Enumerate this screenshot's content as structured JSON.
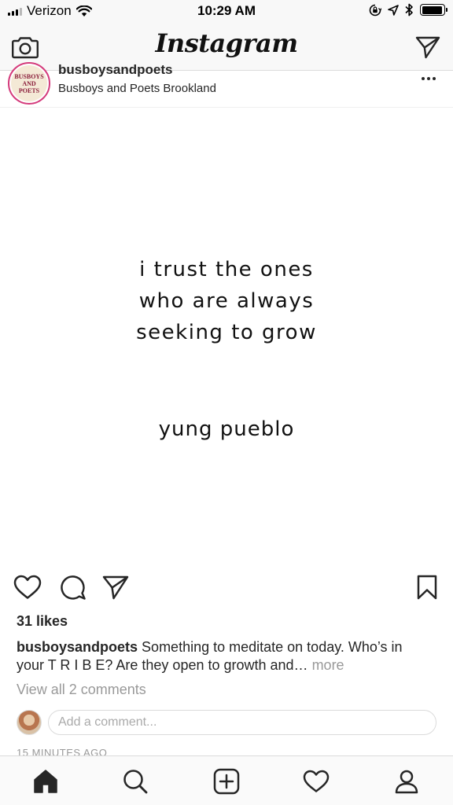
{
  "status_bar": {
    "carrier": "Verizon",
    "time": "10:29 AM",
    "icons": [
      "signal-bars-icon",
      "wifi-icon",
      "rotation-lock-icon",
      "location-arrow-icon",
      "bluetooth-icon",
      "battery-icon"
    ],
    "battery_level": 0.95
  },
  "header": {
    "title": "Instagram",
    "left_icon": "camera-icon",
    "right_icon": "direct-message-icon"
  },
  "post": {
    "username": "busboysandpoets",
    "location": "Busboys and Poets Brookland",
    "avatar_text": [
      "BUSBOYS",
      "AND",
      "POETS"
    ],
    "image": {
      "quote_lines": [
        "i trust the ones",
        "who are always",
        "seeking to grow"
      ],
      "author": "yung pueblo"
    },
    "likes": "31 likes",
    "caption": {
      "user": "busboysandpoets",
      "text": "Something to meditate on today. Who’s in your T R I B E? Are they open to growth and…",
      "more": "more"
    },
    "view_comments": "View all 2 comments",
    "comment_placeholder": "Add a comment...",
    "timestamp": "15 MINUTES AGO"
  },
  "tab_bar": {
    "items": [
      "home-icon",
      "search-icon",
      "add-post-icon",
      "activity-heart-icon",
      "profile-icon"
    ],
    "active": "home-icon"
  },
  "colors": {
    "text": "#262626",
    "muted": "#999999",
    "border": "#dbdbdb",
    "avatar_ring": "#d43a7b"
  }
}
